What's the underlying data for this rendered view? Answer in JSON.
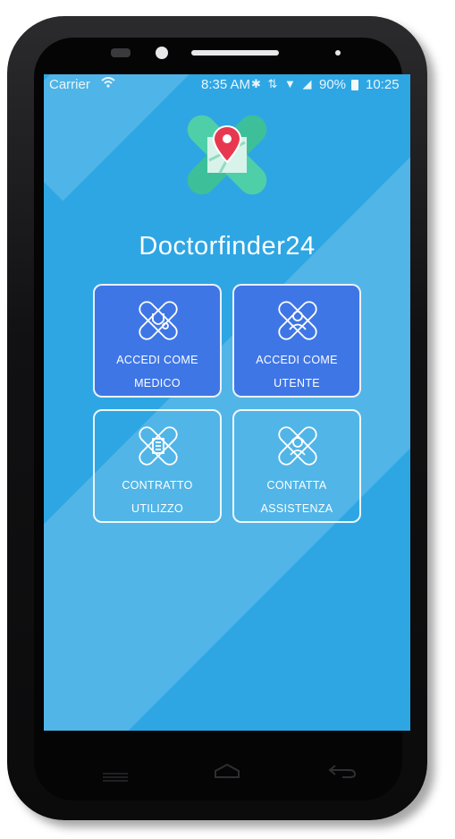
{
  "status_bar": {
    "carrier": "Carrier",
    "wifi_icon": "wifi-icon",
    "time_center": "8:35 AM",
    "icons": "✱ ⇅ ▼ ◢",
    "battery_percent": "90%",
    "clock": "10:25"
  },
  "app": {
    "title": "Doctorfinder24",
    "logo_icon": "map-pin-cross-logo-icon"
  },
  "tiles": [
    {
      "label": "ACCEDI COME\nMEDICO",
      "icon": "stethoscope-icon"
    },
    {
      "label": "ACCEDI COME\nUTENTE",
      "icon": "user-icon"
    },
    {
      "label": "CONTRATTO\nUTILIZZO",
      "icon": "document-icon"
    },
    {
      "label": "CONTATTA\nASSISTENZA",
      "icon": "support-agent-icon"
    }
  ],
  "colors": {
    "screen_bg": "#2ea6e3",
    "tile_active": "#3f76e6",
    "logo_teal": "#3dbf9a",
    "pin_red": "#e8384f"
  }
}
